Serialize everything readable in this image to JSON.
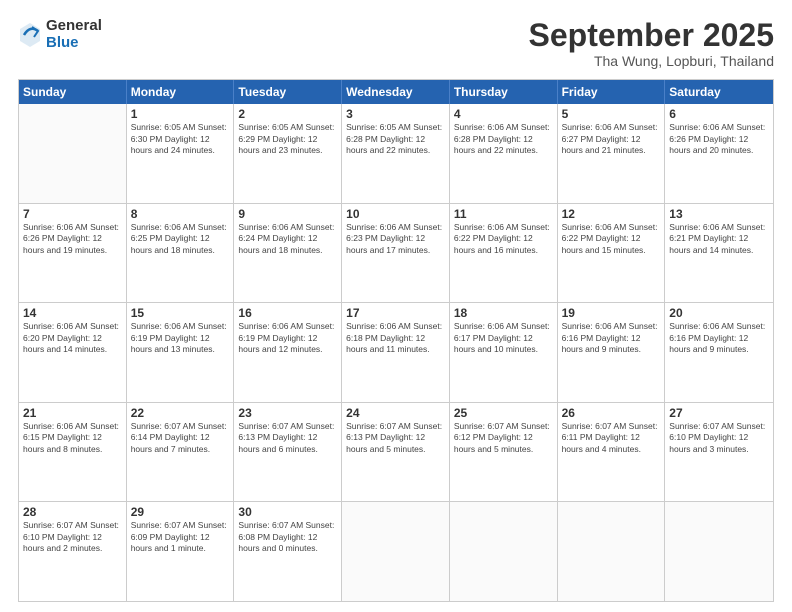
{
  "header": {
    "logo": {
      "general": "General",
      "blue": "Blue"
    },
    "title": "September 2025",
    "location": "Tha Wung, Lopburi, Thailand"
  },
  "calendar": {
    "days": [
      "Sunday",
      "Monday",
      "Tuesday",
      "Wednesday",
      "Thursday",
      "Friday",
      "Saturday"
    ],
    "rows": [
      [
        {
          "day": "",
          "text": ""
        },
        {
          "day": "1",
          "text": "Sunrise: 6:05 AM\nSunset: 6:30 PM\nDaylight: 12 hours\nand 24 minutes."
        },
        {
          "day": "2",
          "text": "Sunrise: 6:05 AM\nSunset: 6:29 PM\nDaylight: 12 hours\nand 23 minutes."
        },
        {
          "day": "3",
          "text": "Sunrise: 6:05 AM\nSunset: 6:28 PM\nDaylight: 12 hours\nand 22 minutes."
        },
        {
          "day": "4",
          "text": "Sunrise: 6:06 AM\nSunset: 6:28 PM\nDaylight: 12 hours\nand 22 minutes."
        },
        {
          "day": "5",
          "text": "Sunrise: 6:06 AM\nSunset: 6:27 PM\nDaylight: 12 hours\nand 21 minutes."
        },
        {
          "day": "6",
          "text": "Sunrise: 6:06 AM\nSunset: 6:26 PM\nDaylight: 12 hours\nand 20 minutes."
        }
      ],
      [
        {
          "day": "7",
          "text": "Sunrise: 6:06 AM\nSunset: 6:26 PM\nDaylight: 12 hours\nand 19 minutes."
        },
        {
          "day": "8",
          "text": "Sunrise: 6:06 AM\nSunset: 6:25 PM\nDaylight: 12 hours\nand 18 minutes."
        },
        {
          "day": "9",
          "text": "Sunrise: 6:06 AM\nSunset: 6:24 PM\nDaylight: 12 hours\nand 18 minutes."
        },
        {
          "day": "10",
          "text": "Sunrise: 6:06 AM\nSunset: 6:23 PM\nDaylight: 12 hours\nand 17 minutes."
        },
        {
          "day": "11",
          "text": "Sunrise: 6:06 AM\nSunset: 6:22 PM\nDaylight: 12 hours\nand 16 minutes."
        },
        {
          "day": "12",
          "text": "Sunrise: 6:06 AM\nSunset: 6:22 PM\nDaylight: 12 hours\nand 15 minutes."
        },
        {
          "day": "13",
          "text": "Sunrise: 6:06 AM\nSunset: 6:21 PM\nDaylight: 12 hours\nand 14 minutes."
        }
      ],
      [
        {
          "day": "14",
          "text": "Sunrise: 6:06 AM\nSunset: 6:20 PM\nDaylight: 12 hours\nand 14 minutes."
        },
        {
          "day": "15",
          "text": "Sunrise: 6:06 AM\nSunset: 6:19 PM\nDaylight: 12 hours\nand 13 minutes."
        },
        {
          "day": "16",
          "text": "Sunrise: 6:06 AM\nSunset: 6:19 PM\nDaylight: 12 hours\nand 12 minutes."
        },
        {
          "day": "17",
          "text": "Sunrise: 6:06 AM\nSunset: 6:18 PM\nDaylight: 12 hours\nand 11 minutes."
        },
        {
          "day": "18",
          "text": "Sunrise: 6:06 AM\nSunset: 6:17 PM\nDaylight: 12 hours\nand 10 minutes."
        },
        {
          "day": "19",
          "text": "Sunrise: 6:06 AM\nSunset: 6:16 PM\nDaylight: 12 hours\nand 9 minutes."
        },
        {
          "day": "20",
          "text": "Sunrise: 6:06 AM\nSunset: 6:16 PM\nDaylight: 12 hours\nand 9 minutes."
        }
      ],
      [
        {
          "day": "21",
          "text": "Sunrise: 6:06 AM\nSunset: 6:15 PM\nDaylight: 12 hours\nand 8 minutes."
        },
        {
          "day": "22",
          "text": "Sunrise: 6:07 AM\nSunset: 6:14 PM\nDaylight: 12 hours\nand 7 minutes."
        },
        {
          "day": "23",
          "text": "Sunrise: 6:07 AM\nSunset: 6:13 PM\nDaylight: 12 hours\nand 6 minutes."
        },
        {
          "day": "24",
          "text": "Sunrise: 6:07 AM\nSunset: 6:13 PM\nDaylight: 12 hours\nand 5 minutes."
        },
        {
          "day": "25",
          "text": "Sunrise: 6:07 AM\nSunset: 6:12 PM\nDaylight: 12 hours\nand 5 minutes."
        },
        {
          "day": "26",
          "text": "Sunrise: 6:07 AM\nSunset: 6:11 PM\nDaylight: 12 hours\nand 4 minutes."
        },
        {
          "day": "27",
          "text": "Sunrise: 6:07 AM\nSunset: 6:10 PM\nDaylight: 12 hours\nand 3 minutes."
        }
      ],
      [
        {
          "day": "28",
          "text": "Sunrise: 6:07 AM\nSunset: 6:10 PM\nDaylight: 12 hours\nand 2 minutes."
        },
        {
          "day": "29",
          "text": "Sunrise: 6:07 AM\nSunset: 6:09 PM\nDaylight: 12 hours\nand 1 minute."
        },
        {
          "day": "30",
          "text": "Sunrise: 6:07 AM\nSunset: 6:08 PM\nDaylight: 12 hours\nand 0 minutes."
        },
        {
          "day": "",
          "text": ""
        },
        {
          "day": "",
          "text": ""
        },
        {
          "day": "",
          "text": ""
        },
        {
          "day": "",
          "text": ""
        }
      ]
    ]
  }
}
